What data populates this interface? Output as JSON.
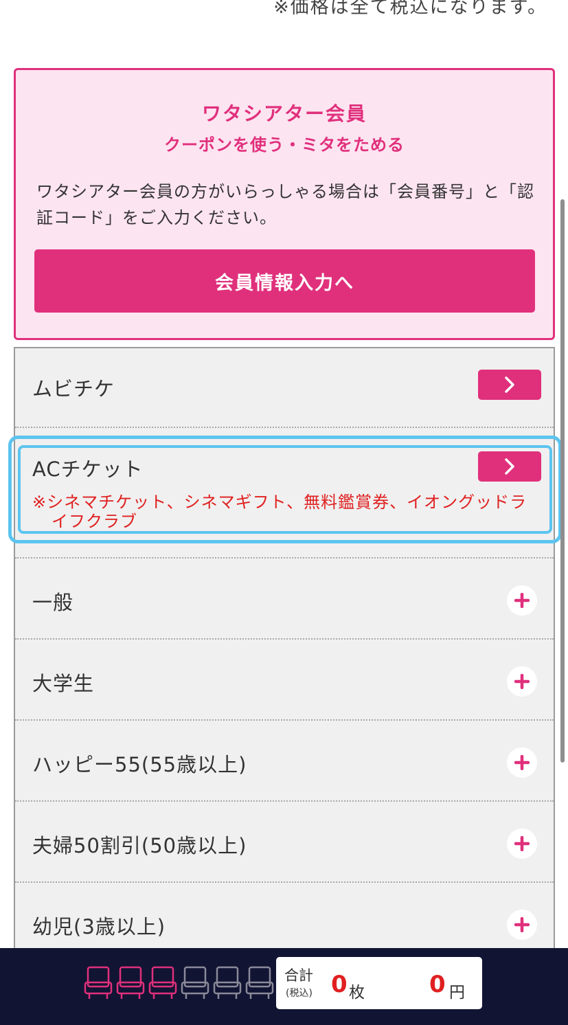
{
  "tax_note": "※価格は全て税込になります。",
  "member": {
    "title": "ワタシアター会員",
    "subtitle": "クーポンを使う・ミタをためる",
    "description": "ワタシアター会員の方がいらっしゃる場合は「会員番号」と「認証コード」をご入力ください。",
    "button_label": "会員情報入力へ"
  },
  "tickets": {
    "mubichike": {
      "label": "ムビチケ",
      "icon": "chevron-right-icon"
    },
    "ac_ticket": {
      "label": "ACチケット",
      "note": "※シネマチケット、シネマギフト、無料鑑賞券、イオングッドライフクラブ",
      "icon": "chevron-right-icon"
    },
    "general": {
      "label": "一般",
      "icon": "plus-icon"
    },
    "university": {
      "label": "大学生",
      "icon": "plus-icon"
    },
    "happy55": {
      "label": "ハッピー55(55歳以上)",
      "icon": "plus-icon"
    },
    "couple50": {
      "label": "夫婦50割引(50歳以上)",
      "icon": "plus-icon"
    },
    "infant": {
      "label": "幼児(3歳以上)",
      "icon": "plus-icon"
    }
  },
  "footer": {
    "seats_selected": 3,
    "seats_total": 6,
    "total_label": "合計",
    "tax_label": "(税込)",
    "count_value": "0",
    "count_unit": "枚",
    "price_value": "0",
    "price_unit": "円"
  },
  "colors": {
    "accent": "#e0307c",
    "member_bg": "#fde4f1",
    "highlight": "#5cc4ef",
    "note_red": "#e02020",
    "footer_bg": "#121433",
    "seat_selected": "#e0307c",
    "seat_empty": "#8a8a9a"
  }
}
